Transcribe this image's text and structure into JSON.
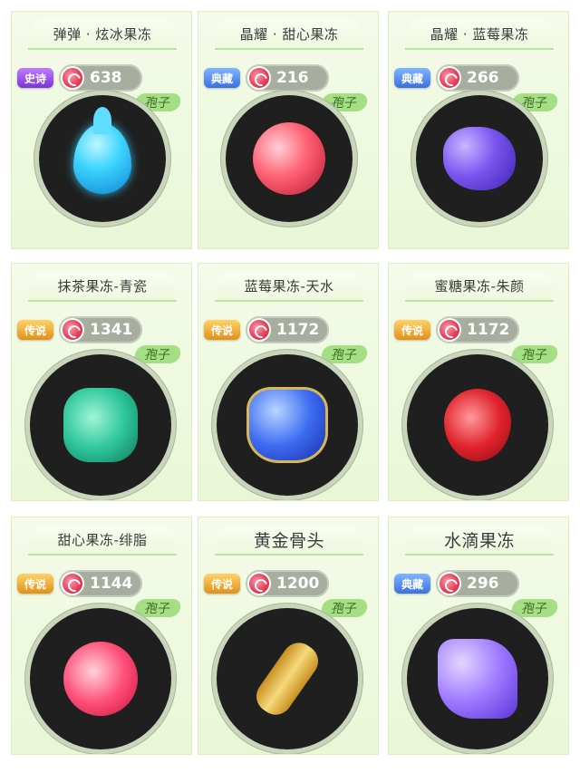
{
  "items": [
    {
      "title": "弹弹 · 炫冰果冻",
      "rarity": "史诗",
      "price": "638",
      "tag": "孢子"
    },
    {
      "title": "晶耀 · 甜心果冻",
      "rarity": "典藏",
      "price": "216",
      "tag": "孢子"
    },
    {
      "title": "晶耀 · 蓝莓果冻",
      "rarity": "典藏",
      "price": "266",
      "tag": "孢子"
    },
    {
      "title": "抹茶果冻-青瓷",
      "rarity": "传说",
      "price": "1341",
      "tag": "孢子"
    },
    {
      "title": "蓝莓果冻-天水",
      "rarity": "传说",
      "price": "1172",
      "tag": "孢子"
    },
    {
      "title": "蜜糖果冻-朱颜",
      "rarity": "传说",
      "price": "1172",
      "tag": "孢子"
    },
    {
      "title": "甜心果冻-绯脂",
      "rarity": "传说",
      "price": "1144",
      "tag": "孢子"
    },
    {
      "title": "黄金骨头",
      "rarity": "传说",
      "price": "1200",
      "tag": "孢子"
    },
    {
      "title": "水滴果冻",
      "rarity": "典藏",
      "price": "296",
      "tag": "孢子"
    }
  ]
}
